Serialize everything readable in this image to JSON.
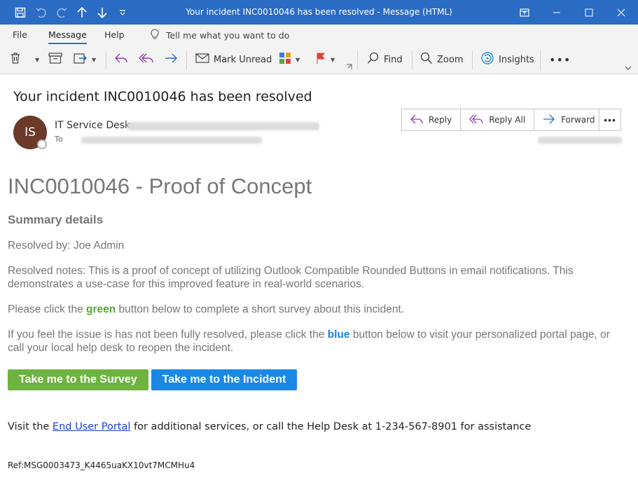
{
  "window": {
    "title": "Your incident INC0010046 has been resolved  -  Message (HTML)",
    "accent_color": "#2b6cc4",
    "quick_access_icons": [
      "save-icon",
      "undo-icon",
      "redo-icon",
      "arrow-up-icon",
      "arrow-down-icon",
      "customize-icon"
    ],
    "controls": [
      "restore-view-icon",
      "minimize-icon",
      "maximize-icon",
      "close-icon"
    ]
  },
  "ribbon": {
    "tabs": [
      "File",
      "Message",
      "Help"
    ],
    "active_tab": "Message",
    "tell_me": "Tell me what you want to do",
    "mark_unread": "Mark Unread",
    "find": "Find",
    "zoom": "Zoom",
    "insights": "Insights"
  },
  "message": {
    "subject": "Your incident INC0010046 has been resolved",
    "avatar_initials": "IS",
    "sender_name": "IT Service Desk",
    "to_label": "To",
    "reply": "Reply",
    "reply_all": "Reply All",
    "forward": "Forward"
  },
  "body": {
    "heading": "INC0010046 - Proof of Concept",
    "summary_title": "Summary details",
    "resolved_by": "Resolved by: Joe Admin",
    "resolved_notes": "Resolved notes: This is a proof of concept of utilizing Outlook Compatible Rounded Buttons in email notifications. This demonstrates a use-case for this improved feature in real-world scenarios.",
    "survey_prefix": "Please click the ",
    "survey_color_word": "green",
    "survey_suffix": " button below to complete a short survey about this incident.",
    "incident_prefix": "If you feel the issue is has not been fully resolved, please click the ",
    "incident_color_word": "blue",
    "incident_suffix": " button below to visit your personalized portal page, or call your local help desk to reopen the incident.",
    "survey_button": "Take me to the Survey",
    "incident_button": "Take me to the Incident",
    "visit_prefix": "Visit the ",
    "portal_link": "End User Portal",
    "visit_suffix": " for additional services, or call the Help Desk at 1-234-567-8901 for assistance",
    "ref": "Ref:MSG0003473_K4465uaKX10vt7MCMHu4",
    "green_color": "#6db33f",
    "blue_color": "#1a88e5"
  }
}
